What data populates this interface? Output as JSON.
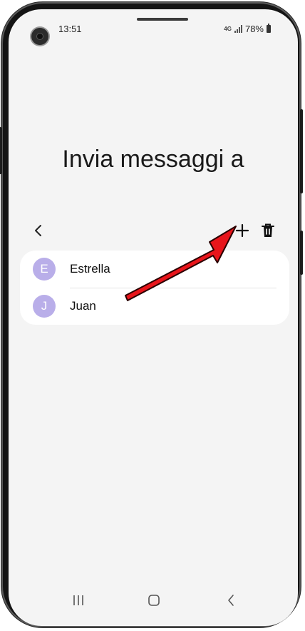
{
  "status_bar": {
    "time": "13:51",
    "network": "4G",
    "battery": "78%"
  },
  "page": {
    "title": "Invia messaggi a"
  },
  "toolbar": {
    "back_icon": "chevron-left-icon",
    "add_icon": "plus-icon",
    "delete_icon": "trash-icon"
  },
  "contacts": [
    {
      "initial": "E",
      "name": "Estrella"
    },
    {
      "initial": "J",
      "name": "Juan"
    }
  ],
  "navigation": {
    "recents_icon": "recents-icon",
    "home_icon": "home-icon",
    "back_icon": "back-icon"
  },
  "colors": {
    "avatar": "#b9aee9",
    "annotation_arrow": "#e8151b",
    "screen_background": "#f4f4f4"
  }
}
